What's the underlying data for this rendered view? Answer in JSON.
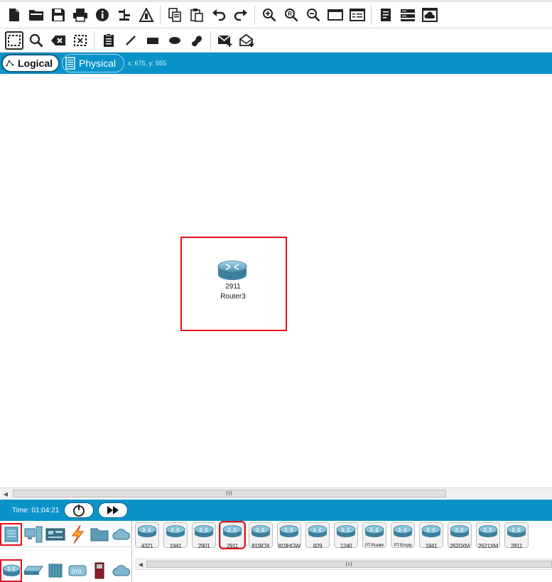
{
  "mode_tabs": {
    "logical": "Logical",
    "physical": "Physical"
  },
  "coords_text": "x: 675, y: 555",
  "device": {
    "model": "2911",
    "name": "Router3"
  },
  "time_text": "Time: 01:04:21",
  "scroll_grip": "III",
  "device_models": [
    "4321",
    "1941",
    "2901",
    "2911",
    "819IOX",
    "819HGW",
    "829",
    "1240",
    "PT-Router",
    "PT-Empty",
    "1841",
    "2620XM",
    "2621XM",
    "2811"
  ],
  "selected_model": "2911",
  "colors": {
    "accent_blue": "#0a93c9",
    "highlight_red": "#e0101e"
  },
  "icons": {
    "toolbar_main": [
      "new-file-icon",
      "open-folder-icon",
      "save-icon",
      "print-icon",
      "info-icon",
      "activity-wizard-icon",
      "network-info-icon",
      "copy-icon",
      "paste-icon",
      "undo-icon",
      "redo-icon",
      "zoom-in-icon",
      "zoom-reset-icon",
      "zoom-out-icon",
      "palette-icon",
      "custom-device-icon",
      "text-editor-icon",
      "server-rack-icon",
      "cloud-icon"
    ],
    "toolbar_tools": [
      "select-icon",
      "inspect-icon",
      "delete-icon",
      "resize-icon",
      "note-icon",
      "line-icon",
      "rectangle-icon",
      "ellipse-icon",
      "freeform-icon",
      "simple-pdu-icon",
      "complex-pdu-icon"
    ]
  }
}
